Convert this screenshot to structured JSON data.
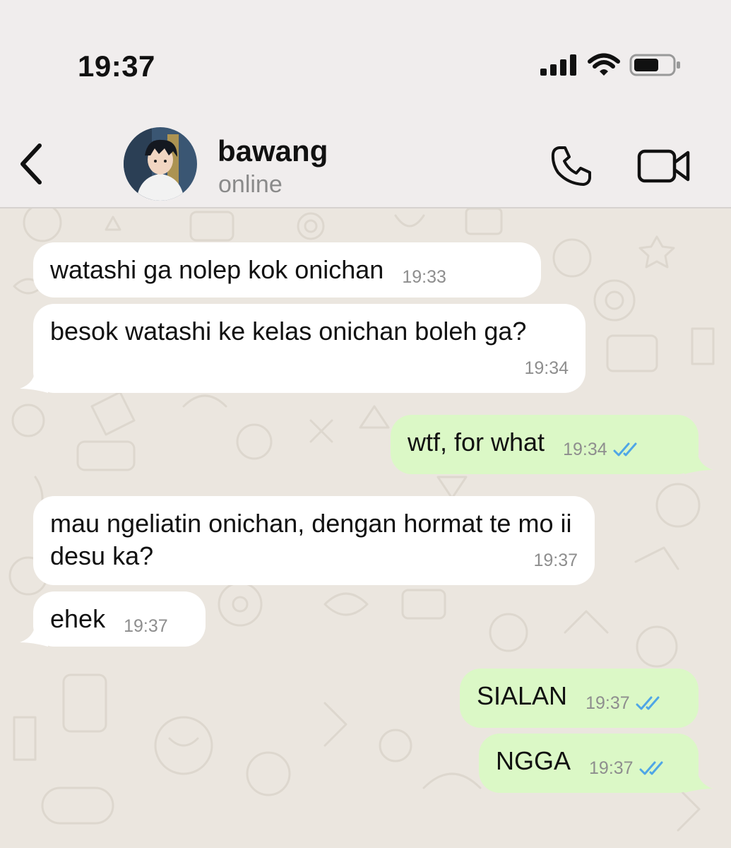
{
  "status_bar": {
    "time": "19:37"
  },
  "header": {
    "contact_name": "bawang",
    "contact_status": "online"
  },
  "messages": [
    {
      "direction": "incoming",
      "text": "watashi ga nolep kok onichan",
      "time": "19:33"
    },
    {
      "direction": "incoming",
      "text": "besok watashi ke kelas onichan boleh ga?",
      "time": "19:34"
    },
    {
      "direction": "outgoing",
      "text": "wtf, for what",
      "time": "19:34",
      "read": true
    },
    {
      "direction": "incoming",
      "text": "mau ngeliatin onichan, dengan hormat te mo ii desu ka?",
      "time": "19:37"
    },
    {
      "direction": "incoming",
      "text": "ehek",
      "time": "19:37"
    },
    {
      "direction": "outgoing",
      "text": "SIALAN",
      "time": "19:37",
      "read": true
    },
    {
      "direction": "outgoing",
      "text": "NGGA",
      "time": "19:37",
      "read": true
    }
  ],
  "colors": {
    "incoming_bubble": "#ffffff",
    "outgoing_bubble": "#dbf8c6",
    "read_ticks": "#4fa6e6",
    "chat_background": "#ebe6df",
    "header_background": "#f0eded"
  },
  "icons": [
    "signal-icon",
    "wifi-icon",
    "battery-icon",
    "back-chevron-icon",
    "phone-icon",
    "video-camera-icon",
    "double-check-icon"
  ]
}
